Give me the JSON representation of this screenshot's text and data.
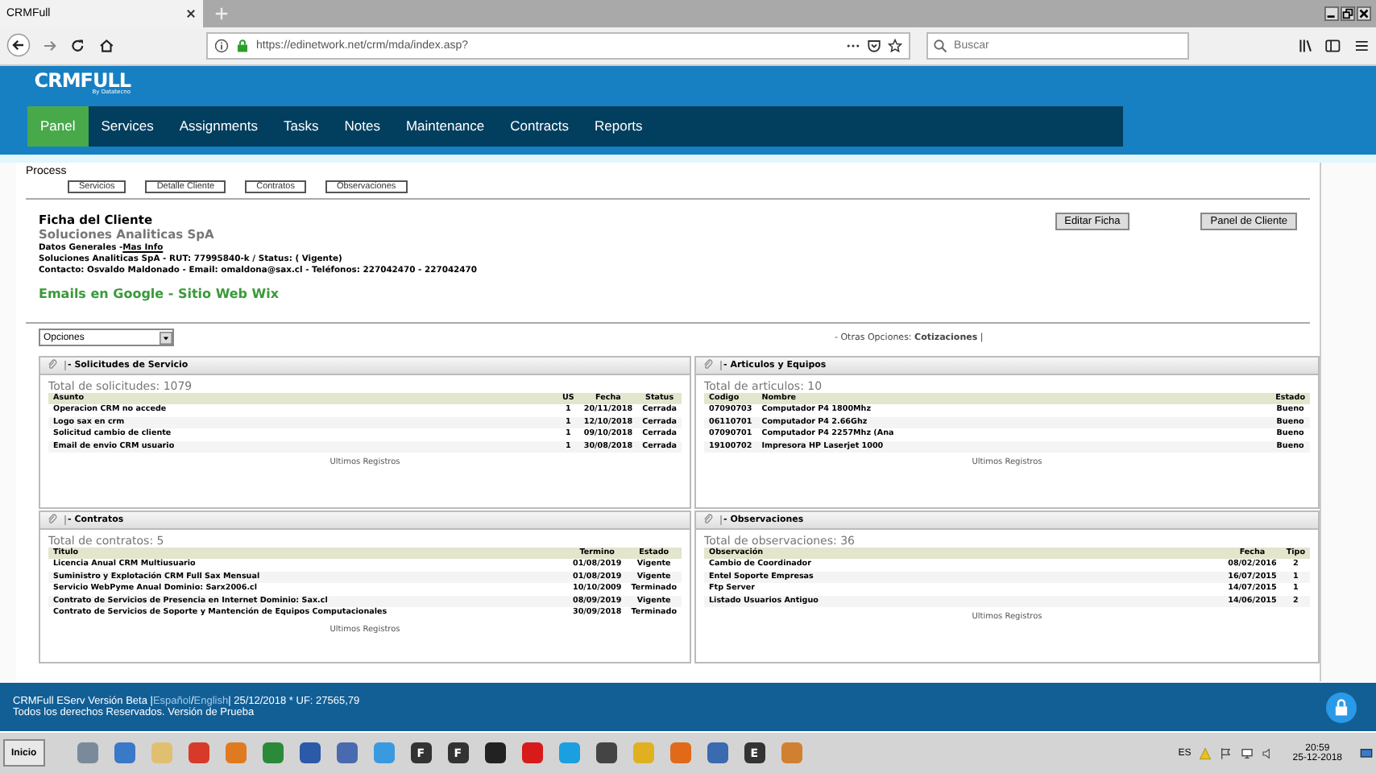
{
  "browser": {
    "tab_title": "CRMFull",
    "url": "https://edinetwork.net/crm/mda/index.asp?",
    "search_placeholder": "Buscar"
  },
  "header": {
    "logo": "CRMFULL",
    "logo_sub": "By Datatecno",
    "nav": [
      {
        "label": "Panel",
        "selected": true
      },
      {
        "label": "Services",
        "selected": false
      },
      {
        "label": "Assignments",
        "selected": false
      },
      {
        "label": "Tasks",
        "selected": false
      },
      {
        "label": "Notes",
        "selected": false
      },
      {
        "label": "Maintenance",
        "selected": false
      },
      {
        "label": "Contracts",
        "selected": false
      },
      {
        "label": "Reports",
        "selected": false
      }
    ]
  },
  "process": {
    "label": "Process",
    "buttons": [
      "Servicios",
      "Detalle Cliente",
      "Contratos",
      "Observaciones"
    ]
  },
  "client": {
    "title": "Ficha del Cliente",
    "company": "Soluciones Analiticas SpA",
    "datos_label": "Datos Generales -",
    "mas_info": "Mas Info",
    "line1": "Soluciones Analiticas SpA - RUT: 77995840-k / Status: ( Vigente)",
    "line2": "Contacto: Osvaldo Maldonado  - Email: omaldona@sax.cl - Teléfonos: 227042470 - 227042470",
    "services": "Emails en Google - Sitio Web Wix",
    "buttons": [
      "Editar Ficha",
      "Panel de Cliente"
    ]
  },
  "options": {
    "select": "Opciones",
    "otras": "- Otras Opciones: **Cotizaciones** |"
  },
  "panels": [
    {
      "title": "- Solicitudes de Servicio",
      "total": "Total de solicitudes: 1079",
      "columns": [
        "Asunto",
        "US",
        "Fecha",
        "Status"
      ],
      "rows": [
        [
          "Operacion CRM no accede",
          "1",
          "20/11/2018",
          "Cerrada"
        ],
        [
          "Logo sax en crm",
          "1",
          "12/10/2018",
          "Cerrada"
        ],
        [
          "Solicitud cambio de cliente",
          "1",
          "09/10/2018",
          "Cerrada"
        ],
        [
          "Email de envio CRM usuario",
          "1",
          "30/08/2018",
          "Cerrada"
        ]
      ],
      "footer": "Ultimos Registros"
    },
    {
      "title": "- Articulos y Equipos",
      "total": "Total de articulos: 10",
      "columns": [
        "Codigo",
        "Nombre",
        "Estado"
      ],
      "rows": [
        [
          "07090703",
          "Computador P4 1800Mhz",
          "Bueno"
        ],
        [
          "06110701",
          "Computador P4 2.66Ghz",
          "Bueno"
        ],
        [
          "07090701",
          "Computador P4 2257Mhz (Ana",
          "Bueno"
        ],
        [
          "19100702",
          "Impresora HP Laserjet 1000",
          "Bueno"
        ]
      ],
      "footer": "Ultimos Registros"
    },
    {
      "title": "- Contratos",
      "total": "Total de contratos: 5",
      "columns": [
        "Titulo",
        "Termino",
        "Estado"
      ],
      "rows": [
        [
          "Licencia Anual CRM Multiusuario",
          "01/08/2019",
          "Vigente"
        ],
        [
          "Suministro y Explotación CRM Full Sax Mensual",
          "01/08/2019",
          "Vigente"
        ],
        [
          "Servicio WebPyme Anual Dominio: Sarx2006.cl",
          "10/10/2009",
          "Terminado"
        ],
        [
          "Contrato de Servicios de Presencia en Internet Dominio: Sax.cl",
          "08/09/2019",
          "Vigente"
        ],
        [
          "Contrato de Servicios de Soporte y Mantención de Equipos Computacionales",
          "30/09/2018",
          "Terminado"
        ]
      ],
      "footer": "Ultimos Registros"
    },
    {
      "title": "- Observaciones",
      "total": "Total de observaciones: 36",
      "columns": [
        "Observación",
        "Fecha",
        "Tipo"
      ],
      "rows": [
        [
          "Cambio de Coordinador",
          "08/02/2016",
          "2"
        ],
        [
          "Entel Soporte Empresas",
          "16/07/2015",
          "1"
        ],
        [
          "Ftp Server",
          "14/07/2015",
          "1"
        ],
        [
          "Listado Usuarios Antiguo",
          "14/06/2015",
          "2"
        ]
      ],
      "footer": "Ultimos Registros"
    }
  ],
  "footer": {
    "version": "CRMFull EServ Versión Beta |",
    "lang_es": "Español",
    "sep": "/",
    "lang_en": "English",
    "date_uf": "| 25/12/2018 * UF: 27565,79",
    "rights": "Todos los derechos Reservados. Versión de Prueba"
  },
  "taskbar": {
    "start": "Inicio",
    "apps": [
      {
        "color": "#7a8a9a"
      },
      {
        "color": "#3a78c8"
      },
      {
        "color": "#e0c070"
      },
      {
        "color": "#d83a2a"
      },
      {
        "color": "#e07a20"
      },
      {
        "color": "#2a8a3a"
      },
      {
        "color": "#2a5aa8"
      },
      {
        "color": "#4a6ab0"
      },
      {
        "color": "#3a9ae0"
      },
      {
        "color": "#333333",
        "label": "F"
      },
      {
        "color": "#333333",
        "label": "F"
      },
      {
        "color": "#222222"
      },
      {
        "color": "#d81a1a"
      },
      {
        "color": "#1aa0e0"
      },
      {
        "color": "#444444"
      },
      {
        "color": "#e0b020"
      },
      {
        "color": "#e06a1a"
      },
      {
        "color": "#3a6ab0"
      },
      {
        "color": "#333333",
        "label": "E"
      },
      {
        "color": "#d08030"
      }
    ],
    "lang": "ES",
    "time": "20:59",
    "date": "25-12-2018"
  }
}
